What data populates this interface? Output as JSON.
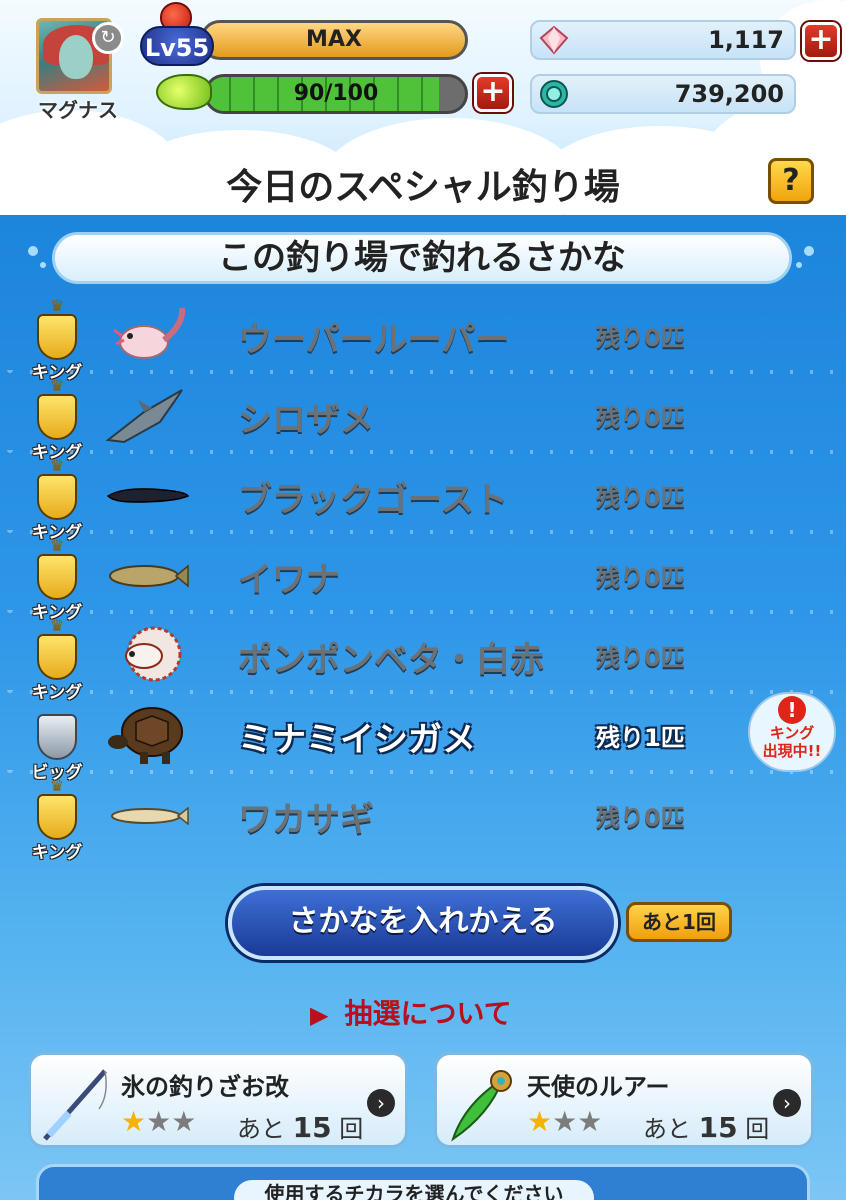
{
  "header": {
    "player_name": "マグナス",
    "level": "Lv55",
    "exp_label": "MAX",
    "stamina_label": "90/100",
    "stamina_fraction": 0.9,
    "currency_gems": "1,117",
    "currency_coins": "739,200"
  },
  "title": "今日のスペシャル釣り場",
  "help_label": "?",
  "section_header": "この釣り場で釣れるさかな",
  "fish_list": [
    {
      "rank": "キング",
      "name": "ウーパールーパー",
      "remaining": "残り0匹",
      "icon": "axolotl-icon"
    },
    {
      "rank": "キング",
      "name": "シロザメ",
      "remaining": "残り0匹",
      "icon": "shark-icon"
    },
    {
      "rank": "キング",
      "name": "ブラックゴースト",
      "remaining": "残り0匹",
      "icon": "ghost-knifefish-icon"
    },
    {
      "rank": "キング",
      "name": "イワナ",
      "remaining": "残り0匹",
      "icon": "char-fish-icon"
    },
    {
      "rank": "キング",
      "name": "ポンポンベタ・白赤",
      "remaining": "残り0匹",
      "icon": "betta-icon"
    },
    {
      "rank": "ビッグ",
      "name": "ミナミイシガメ",
      "remaining": "残り1匹",
      "icon": "turtle-icon"
    },
    {
      "rank": "キング",
      "name": "ワカサギ",
      "remaining": "残り0匹",
      "icon": "smelt-icon"
    }
  ],
  "king_alert": {
    "line1": "キング",
    "line2": "出現中!!"
  },
  "swap_button": "さかなを入れかえる",
  "swap_remaining": "あと1回",
  "lottery_link": "抽選について",
  "equipment": [
    {
      "name": "氷の釣りざお改",
      "stars_on": 1,
      "stars_total": 3,
      "remain_prefix": "あと",
      "remain_count": "15",
      "remain_unit": "回",
      "icon": "fishing-rod-icon"
    },
    {
      "name": "天使のルアー",
      "stars_on": 1,
      "stars_total": 3,
      "remain_prefix": "あと",
      "remain_count": "15",
      "remain_unit": "回",
      "icon": "lure-icon"
    }
  ],
  "bottom_label": "使用するチカラを選んでください",
  "colors": {
    "accent_blue": "#1a8ae0",
    "gold": "#f0a40c",
    "alert_red": "#e02418"
  }
}
